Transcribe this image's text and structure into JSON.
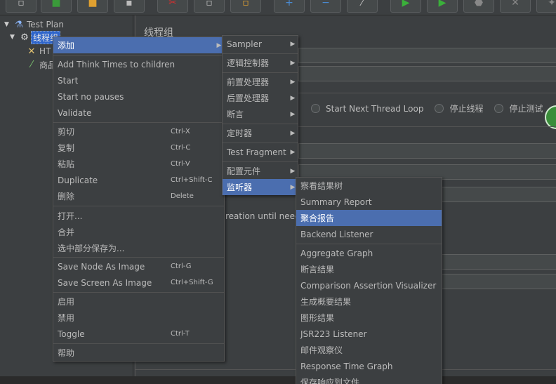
{
  "tree": {
    "items": [
      {
        "label": "Test Plan",
        "icon": "flask-icon"
      },
      {
        "label": "线程组",
        "icon": "gear-icon"
      },
      {
        "label": "HT",
        "icon": "tools-icon"
      },
      {
        "label": "商品",
        "icon": "pipette-icon"
      }
    ]
  },
  "main": {
    "title": "线程组",
    "radio_options": [
      "Start Next Thread Loop",
      "停止线程",
      "停止测试"
    ],
    "partial_text": "reation until neede"
  },
  "context_menu": {
    "items": [
      {
        "label": "添加",
        "submenu": true
      },
      {
        "label": "Add Think Times to children"
      },
      {
        "label": "Start"
      },
      {
        "label": "Start no pauses"
      },
      {
        "label": "Validate"
      },
      {
        "label": "剪切",
        "shortcut": "Ctrl-X"
      },
      {
        "label": "复制",
        "shortcut": "Ctrl-C"
      },
      {
        "label": "粘贴",
        "shortcut": "Ctrl-V"
      },
      {
        "label": "Duplicate",
        "shortcut": "Ctrl+Shift-C"
      },
      {
        "label": "删除",
        "shortcut": "Delete"
      },
      {
        "label": "打开..."
      },
      {
        "label": "合并"
      },
      {
        "label": "选中部分保存为..."
      },
      {
        "label": "Save Node As Image",
        "shortcut": "Ctrl-G"
      },
      {
        "label": "Save Screen As Image",
        "shortcut": "Ctrl+Shift-G"
      },
      {
        "label": "启用"
      },
      {
        "label": "禁用"
      },
      {
        "label": "Toggle",
        "shortcut": "Ctrl-T"
      },
      {
        "label": "帮助"
      }
    ]
  },
  "add_submenu": {
    "items": [
      {
        "label": "Sampler"
      },
      {
        "label": "逻辑控制器"
      },
      {
        "label": "前置处理器"
      },
      {
        "label": "后置处理器"
      },
      {
        "label": "断言"
      },
      {
        "label": "定时器"
      },
      {
        "label": "Test Fragment"
      },
      {
        "label": "配置元件"
      },
      {
        "label": "监听器"
      }
    ]
  },
  "listener_submenu": {
    "items": [
      {
        "label": "察看结果树"
      },
      {
        "label": "Summary Report"
      },
      {
        "label": "聚合报告"
      },
      {
        "label": "Backend Listener"
      },
      {
        "label": "Aggregate Graph"
      },
      {
        "label": "断言结果"
      },
      {
        "label": "Comparison Assertion Visualizer"
      },
      {
        "label": "生成概要结果"
      },
      {
        "label": "图形结果"
      },
      {
        "label": "JSR223 Listener"
      },
      {
        "label": "邮件观察仪"
      },
      {
        "label": "Response Time Graph"
      },
      {
        "label": "保存响应到文件"
      }
    ]
  },
  "colors": {
    "background": "#3c3f41",
    "highlight": "#4b6eaf",
    "selection": "#2f65ca"
  }
}
